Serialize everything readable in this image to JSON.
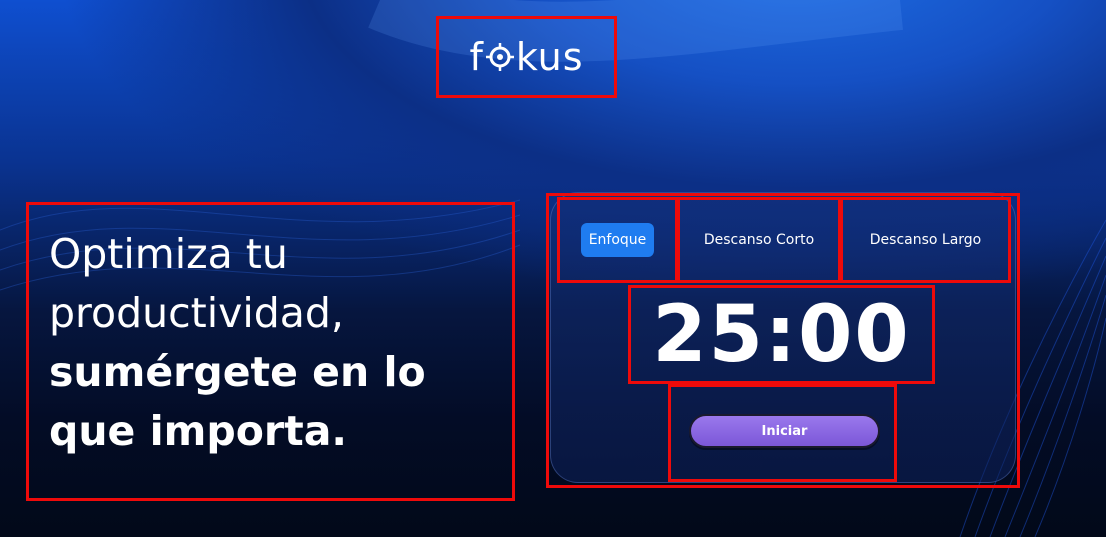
{
  "logo": {
    "text_left": "f",
    "text_right": "kus",
    "icon": "target-icon"
  },
  "headline": {
    "line1": "Optimiza tu",
    "line2": "productividad,",
    "line3": "sumérgete en lo",
    "line4": "que importa."
  },
  "timer": {
    "tabs": [
      {
        "label": "Enfoque",
        "active": true
      },
      {
        "label": "Descanso Corto",
        "active": false
      },
      {
        "label": "Descanso Largo",
        "active": false
      }
    ],
    "time": "25:00",
    "start_label": "Iniciar"
  },
  "colors": {
    "accent_tab": "#1f7cf0",
    "start_button": "#8a66e2",
    "annotation_outline": "#ee0a0a"
  }
}
